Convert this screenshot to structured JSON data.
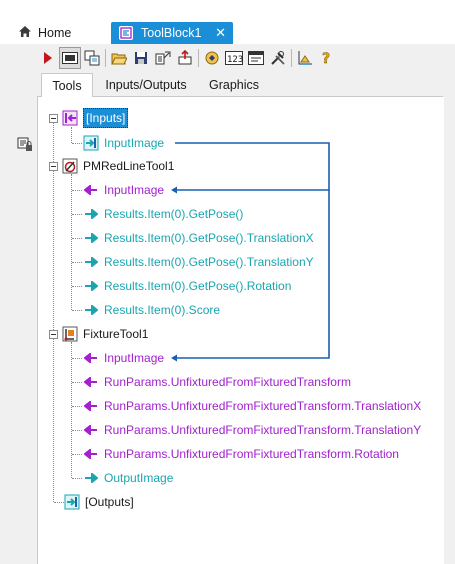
{
  "tabs": {
    "home": "Home",
    "toolblock": "ToolBlock1"
  },
  "toolbar": {
    "buttons": [
      "run-icon",
      "toggle-display-icon",
      "copy-icon",
      "open-icon",
      "save-icon",
      "import-icon",
      "export-icon",
      "reset-icon",
      "numeric-icon",
      "terminal-icon",
      "tools-icon",
      "chart-icon",
      "help-icon"
    ]
  },
  "inner_tabs": [
    "Tools",
    "Inputs/Outputs",
    "Graphics"
  ],
  "tree": {
    "inputs": {
      "label": "[Inputs]",
      "children": [
        "InputImage"
      ]
    },
    "pm_tool": {
      "label": "PMRedLineTool1",
      "children": [
        "InputImage",
        "Results.Item(0).GetPose()",
        "Results.Item(0).GetPose().TranslationX",
        "Results.Item(0).GetPose().TranslationY",
        "Results.Item(0).GetPose().Rotation",
        "Results.Item(0).Score"
      ]
    },
    "fixture_tool": {
      "label": "FixtureTool1",
      "children": [
        "InputImage",
        "RunParams.UnfixturedFromFixturedTransform",
        "RunParams.UnfixturedFromFixturedTransform.TranslationX",
        "RunParams.UnfixturedFromFixturedTransform.TranslationY",
        "RunParams.UnfixturedFromFixturedTransform.Rotation",
        "OutputImage"
      ]
    },
    "outputs": {
      "label": "[Outputs]"
    }
  },
  "colors": {
    "accent": "#1a8fd8",
    "input_link": "#a220d0",
    "output_link": "#1aa6b0",
    "connector": "#1a5fb0"
  }
}
